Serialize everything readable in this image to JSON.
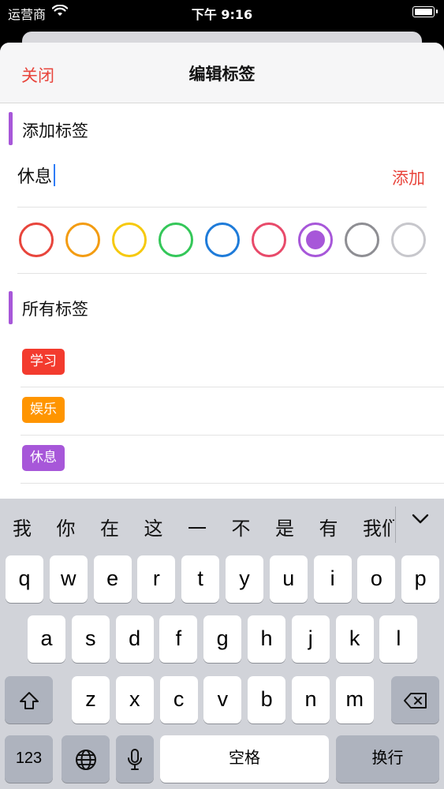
{
  "status": {
    "carrier": "运营商",
    "time": "下午 9:16"
  },
  "nav": {
    "close": "关闭",
    "title": "编辑标签"
  },
  "add_section": {
    "title": "添加标签",
    "input_value": "休息",
    "add_button": "添加",
    "colors": [
      "#e8453c",
      "#f39c12",
      "#f6c90e",
      "#34c759",
      "#1e7bd9",
      "#e84a6a",
      "#a757d9",
      "#8e8e93",
      "#c7c7cc"
    ],
    "selected_color_index": 6
  },
  "all_section": {
    "title": "所有标签",
    "tags": [
      {
        "label": "学习",
        "color": "#f33b2e"
      },
      {
        "label": "娱乐",
        "color": "#ff9500"
      },
      {
        "label": "休息",
        "color": "#a757d9"
      }
    ]
  },
  "keyboard": {
    "candidates": [
      "我",
      "你",
      "在",
      "这",
      "一",
      "不",
      "是",
      "有",
      "我们"
    ],
    "row1": [
      "q",
      "w",
      "e",
      "r",
      "t",
      "y",
      "u",
      "i",
      "o",
      "p"
    ],
    "row2": [
      "a",
      "s",
      "d",
      "f",
      "g",
      "h",
      "j",
      "k",
      "l"
    ],
    "row3": [
      "z",
      "x",
      "c",
      "v",
      "b",
      "n",
      "m"
    ],
    "num_key": "123",
    "space": "空格",
    "return": "换行"
  }
}
